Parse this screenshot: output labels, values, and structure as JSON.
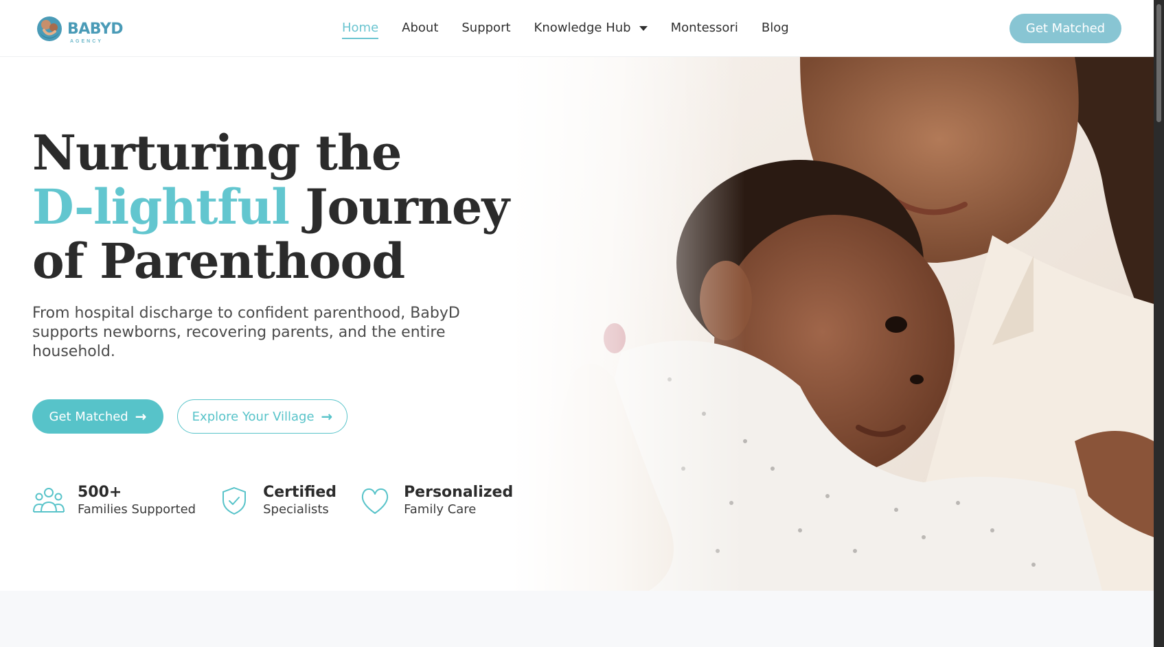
{
  "brand": {
    "name": "BABYD",
    "tagline": "AGENCY",
    "accent_color": "#62c6cf",
    "button_color": "#57c3c9",
    "header_button_color": "#88c5d3"
  },
  "nav": {
    "items": [
      {
        "label": "Home",
        "active": true
      },
      {
        "label": "About"
      },
      {
        "label": "Support"
      },
      {
        "label": "Knowledge Hub",
        "dropdown": true
      },
      {
        "label": "Montessori"
      },
      {
        "label": "Blog"
      }
    ],
    "cta_label": "Get Matched"
  },
  "hero": {
    "headline_line1": "Nurturing the",
    "headline_accent": "D-lightful",
    "headline_line2_rest": " Journey",
    "headline_line3": "of Parenthood",
    "subtext": "From hospital discharge to confident parenthood, BabyD supports newborns, recovering parents, and the entire household.",
    "primary_button": "Get Matched",
    "secondary_button": "Explore Your Village",
    "stats": [
      {
        "title": "500+",
        "subtitle": "Families Supported",
        "icon": "families-icon"
      },
      {
        "title": "Certified",
        "subtitle": "Specialists",
        "icon": "shield-check-icon"
      },
      {
        "title": "Personalized",
        "subtitle": "Family Care",
        "icon": "heart-icon"
      }
    ]
  }
}
